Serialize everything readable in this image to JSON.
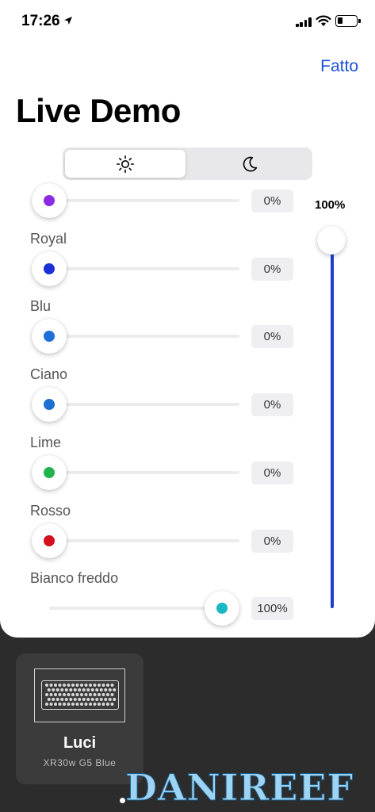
{
  "status_bar": {
    "time": "17:26"
  },
  "header": {
    "done_label": "Fatto",
    "title": "Live Demo"
  },
  "mode_toggle": {
    "selected": "day",
    "options": [
      "day-icon",
      "night-icon"
    ]
  },
  "master": {
    "value": "100%",
    "level": 1.0,
    "color": "#1a3fd0"
  },
  "channels": [
    {
      "label": "",
      "value": "0%",
      "level": 0.0,
      "color": "#8a2be2"
    },
    {
      "label": "Royal",
      "value": "0%",
      "level": 0.0,
      "color": "#1e2fd6"
    },
    {
      "label": "Blu",
      "value": "0%",
      "level": 0.0,
      "color": "#1e6fd8"
    },
    {
      "label": "Ciano",
      "value": "0%",
      "level": 0.0,
      "color": "#1d6fd0"
    },
    {
      "label": "Lime",
      "value": "0%",
      "level": 0.0,
      "color": "#22b24c"
    },
    {
      "label": "Rosso",
      "value": "0%",
      "level": 0.0,
      "color": "#d4101e"
    },
    {
      "label": "Bianco freddo",
      "value": "100%",
      "level": 1.0,
      "color": "#1ab8c4"
    }
  ],
  "device": {
    "name": "Luci",
    "model": "XR30w G5 Blue"
  },
  "watermark": {
    "text": "DANIREEF"
  }
}
